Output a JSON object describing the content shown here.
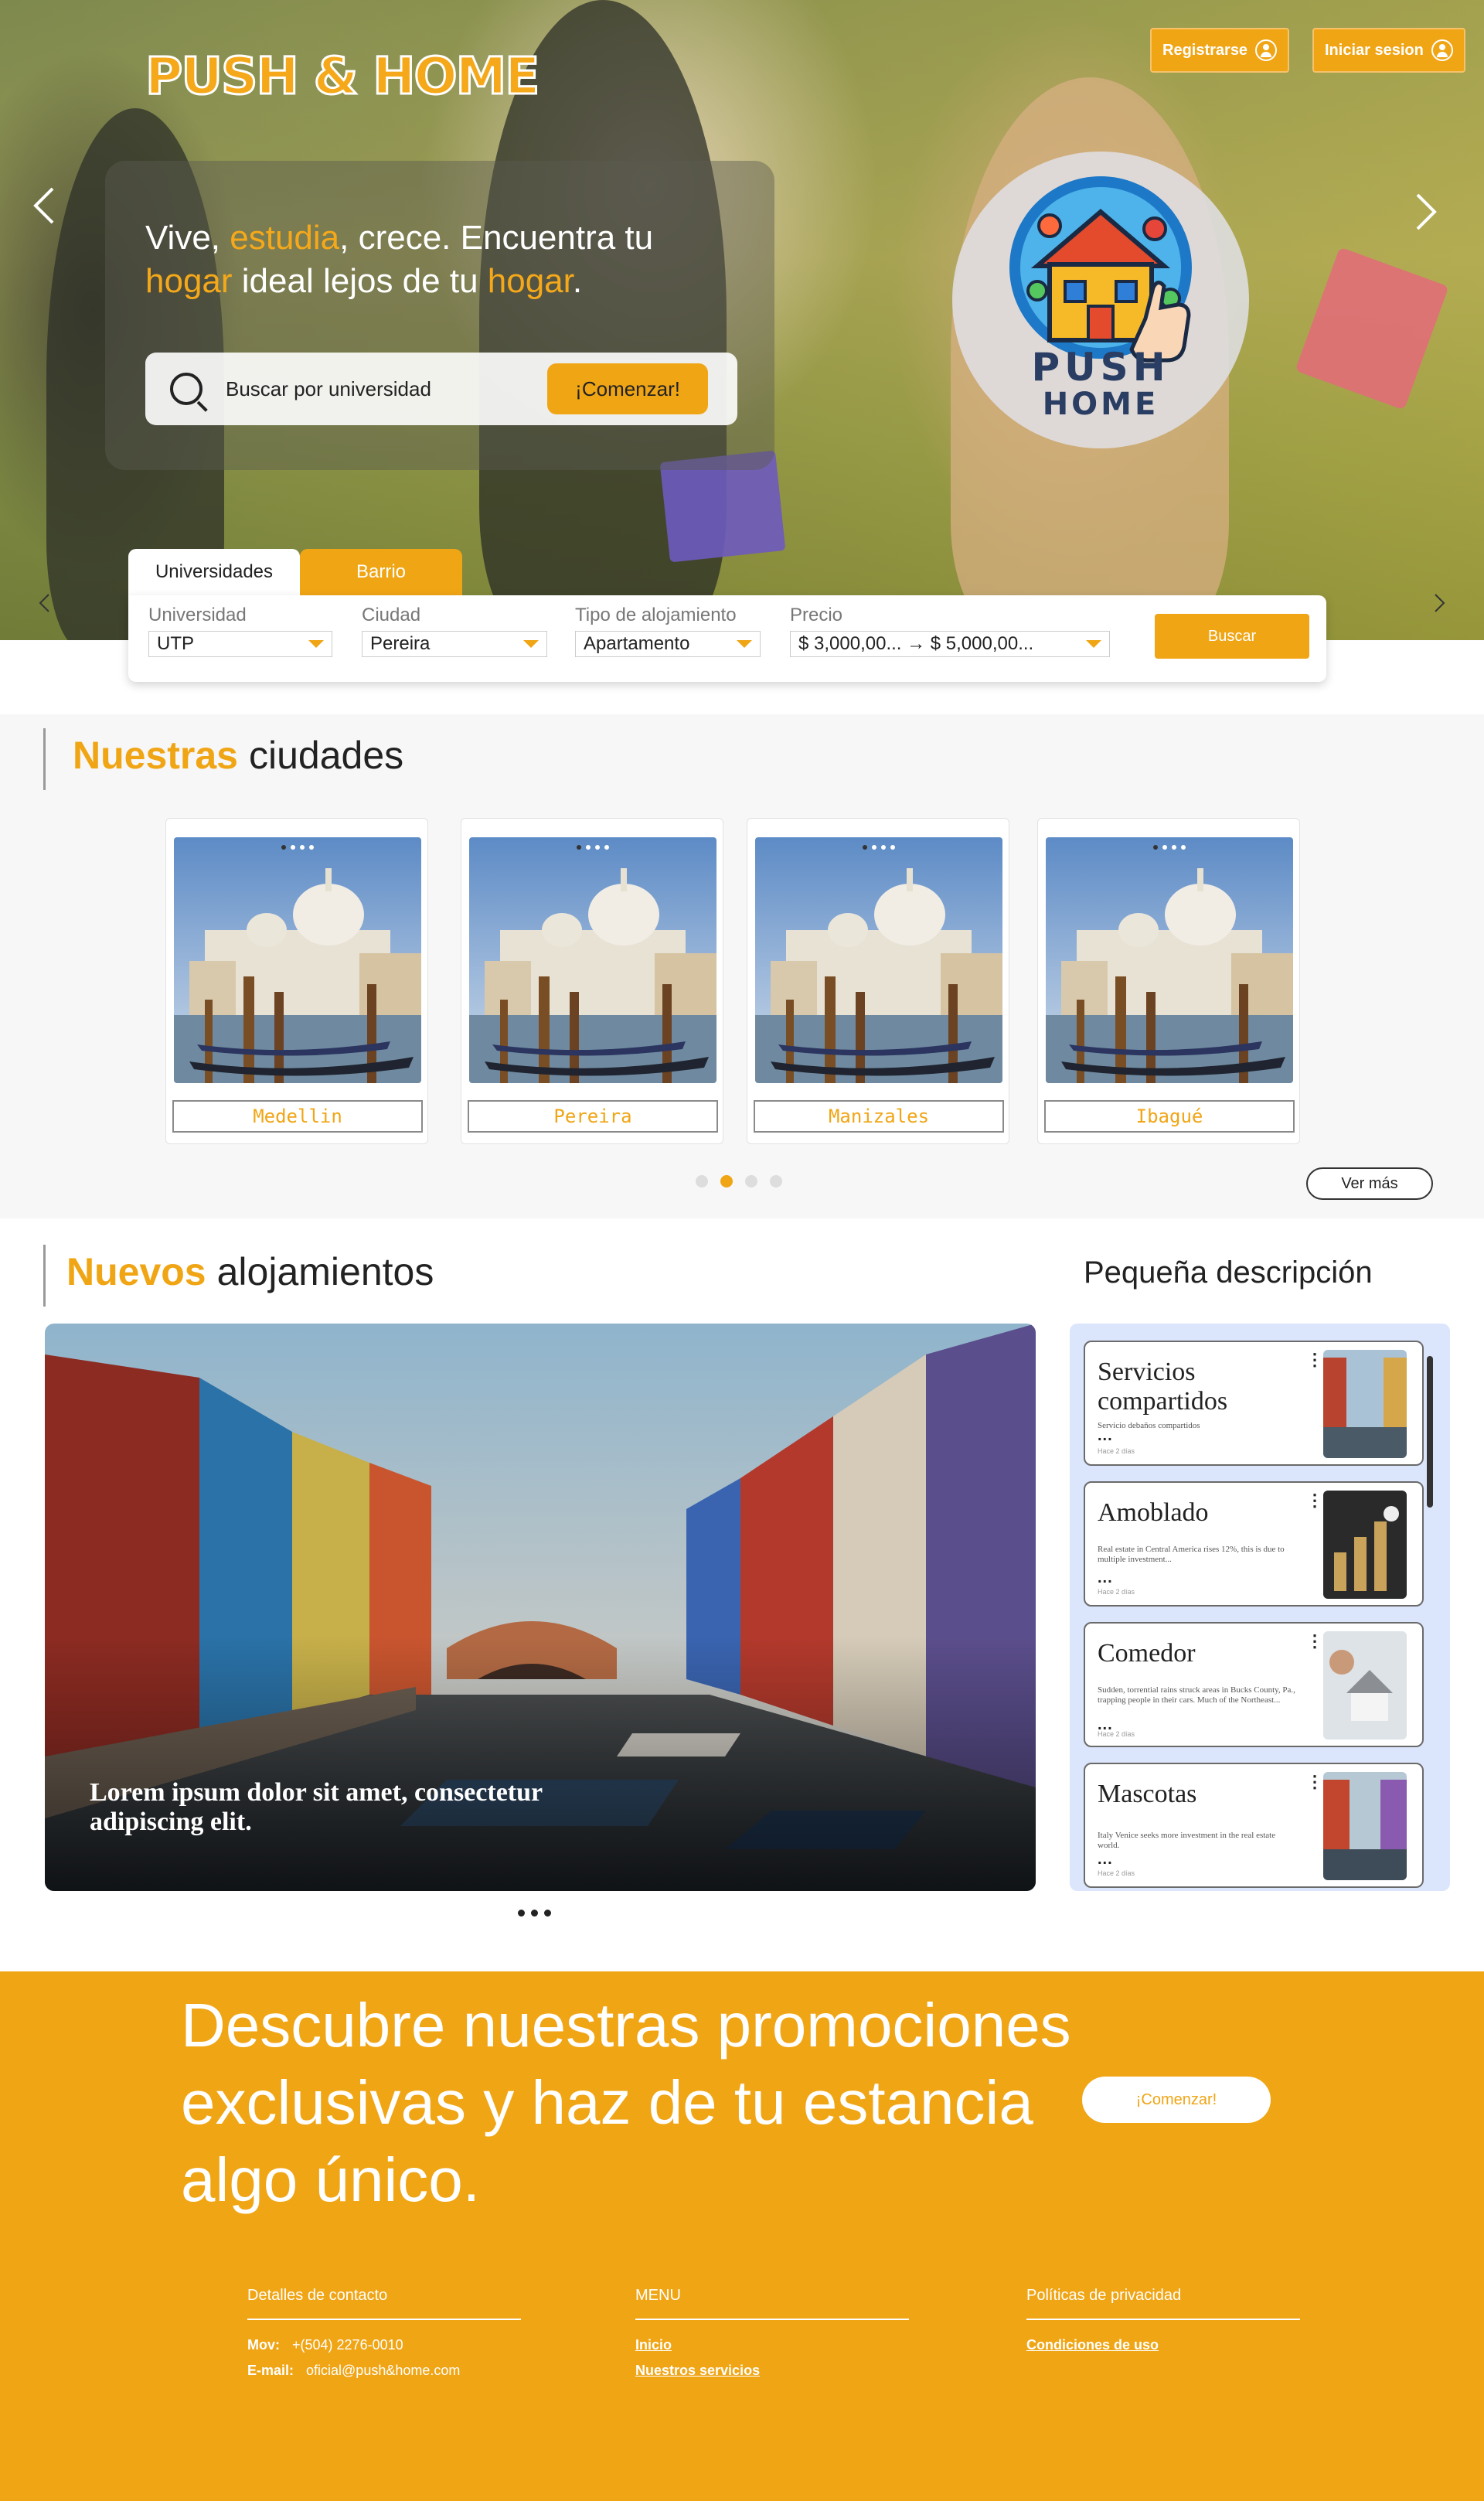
{
  "brand": {
    "logo_text": "PUSH & HOME",
    "accent_color": "#f0a515",
    "badge_text_top": "PUSH",
    "badge_text_bottom": "HOME"
  },
  "header": {
    "register_label": "Registrarse",
    "login_label": "Iniciar sesion"
  },
  "hero": {
    "tagline_parts": [
      "Vive, ",
      "estudia",
      ", crece. Encuentra tu ",
      "hogar",
      " ideal lejos de tu ",
      "hogar",
      "."
    ],
    "search_placeholder": "Buscar por universidad",
    "search_button": "¡Comenzar!",
    "prev_icon": "chevron-left-icon",
    "next_icon": "chevron-right-icon"
  },
  "filters": {
    "tabs": [
      "Universidades",
      "Barrio"
    ],
    "active_tab": "Universidades",
    "university": {
      "label": "Universidad",
      "value": "UTP"
    },
    "city": {
      "label": "Ciudad",
      "value": "Pereira"
    },
    "housing_type": {
      "label": "Tipo de alojamiento",
      "value": "Apartamento"
    },
    "price": {
      "label": "Precio",
      "value": "$ 3,000,00... → $ 5,000,00..."
    },
    "search_button": "Buscar"
  },
  "cities": {
    "title_accent": "Nuestras",
    "title_rest": "ciudades",
    "items": [
      {
        "name": "Medellin"
      },
      {
        "name": "Pereira"
      },
      {
        "name": "Manizales"
      },
      {
        "name": "Ibagué"
      }
    ],
    "active_page": 2,
    "page_count": 4,
    "see_more": "Ver más"
  },
  "new_listings": {
    "title_accent": "Nuevos",
    "title_rest": "alojamientos",
    "feature_caption": "Lorem ipsum dolor sit amet, consectetur adipiscing elit.",
    "side_title": "Pequeña descripción",
    "cards": [
      {
        "title": "Servicios compartidos",
        "desc": "Servicio debaños compartidos",
        "more": "...",
        "time": "Hace 2 días"
      },
      {
        "title": "Amoblado",
        "desc": "Real estate in Central America rises 12%, this is due to multiple investment...",
        "more": "...",
        "time": "Hace 2 días"
      },
      {
        "title": "Comedor",
        "desc": "Sudden, torrential rains struck areas in Bucks County, Pa., trapping people in their cars. Much of the Northeast...",
        "more": "...",
        "time": "Hace 2 días"
      },
      {
        "title": "Mascotas",
        "desc": "Italy Venice seeks more investment in the real estate world.",
        "more": "...",
        "time": "Hace 2 días"
      }
    ]
  },
  "promo": {
    "text": "Descubre nuestras promociones exclusivas y haz de tu estancia algo único.",
    "button": "¡Comenzar!"
  },
  "footer": {
    "contact": {
      "heading": "Detalles de contacto",
      "phone_label": "Mov:",
      "phone": "+(504) 2276-0010",
      "email_label": "E-mail:",
      "email": "oficial@push&home.com"
    },
    "menu": {
      "heading": "MENU",
      "links": [
        "Inicio",
        "Nuestros servicios"
      ]
    },
    "privacy": {
      "heading": "Políticas de privacidad",
      "links": [
        "Condiciones de uso"
      ]
    }
  }
}
